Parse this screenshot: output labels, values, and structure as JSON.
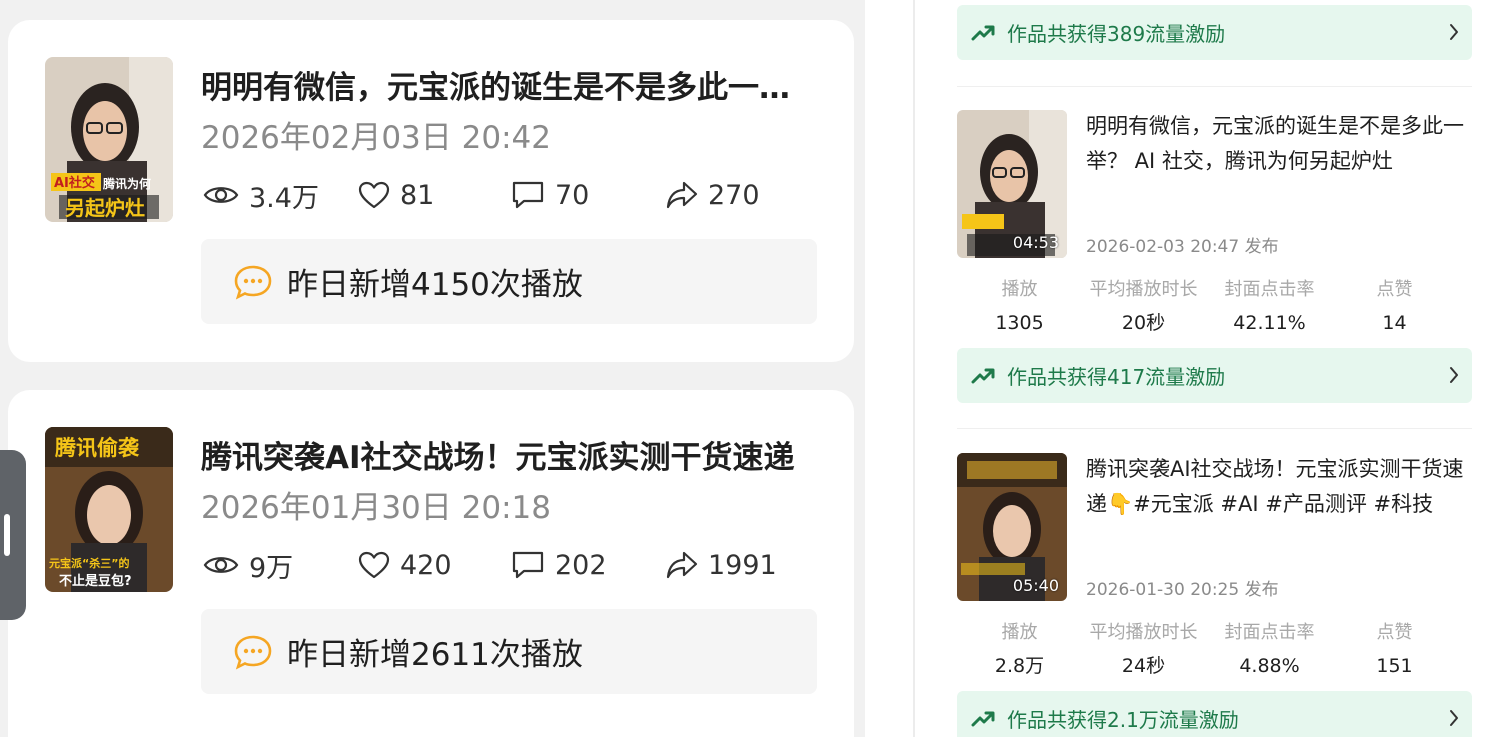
{
  "left": {
    "videos": [
      {
        "title": "明明有微信，元宝派的诞生是不是多此一举？AI社交，腾讯为何另起炉灶",
        "date": "2026年02月03日 20:42",
        "views": "3.4万",
        "likes": "81",
        "comments": "70",
        "shares": "270",
        "yesterday_new": "昨日新增4150次播放",
        "cover": {
          "tag": "AI社交",
          "line1": "腾讯为何",
          "line2": "另起炉灶"
        }
      },
      {
        "title": "腾讯突袭AI社交战场！元宝派实测干货速递",
        "date": "2026年01月30日 20:18",
        "views": "9万",
        "likes": "420",
        "comments": "202",
        "shares": "1991",
        "yesterday_new": "昨日新增2611次播放",
        "cover": {
          "top": "腾讯偷袭",
          "mid": "元宝派“杀三”的",
          "bottom": "不止是豆包?"
        }
      }
    ]
  },
  "right": {
    "banners": [
      "作品共获得389流量激励",
      "作品共获得417流量激励",
      "作品共获得2.1万流量激励"
    ],
    "metric_labels": [
      "播放",
      "平均播放时长",
      "封面点击率",
      "点赞"
    ],
    "videos": [
      {
        "title": "明明有微信，元宝派的诞生是不是多此一举？ AI 社交，腾讯为何另起炉灶",
        "duration": "04:53",
        "published": "2026-02-03 20:47 发布",
        "metrics": [
          "1305",
          "20秒",
          "42.11%",
          "14"
        ]
      },
      {
        "title": "腾讯突袭AI社交战场！元宝派实测干货速递👇#元宝派 #AI #产品测评 #科技",
        "duration": "05:40",
        "published": "2026-01-30 20:25 发布",
        "metrics": [
          "2.8万",
          "24秒",
          "4.88%",
          "151"
        ]
      }
    ]
  },
  "colors": {
    "banner_bg": "#e6f7ee",
    "banner_text": "#1e7a4a",
    "new_icon": "#f5a623",
    "page_bg": "#f1f1f1"
  },
  "icons": [
    "eye-icon",
    "heart-icon",
    "comment-icon",
    "share-icon",
    "chat-bubble-icon",
    "trend-up-icon",
    "chevron-right-icon"
  ]
}
